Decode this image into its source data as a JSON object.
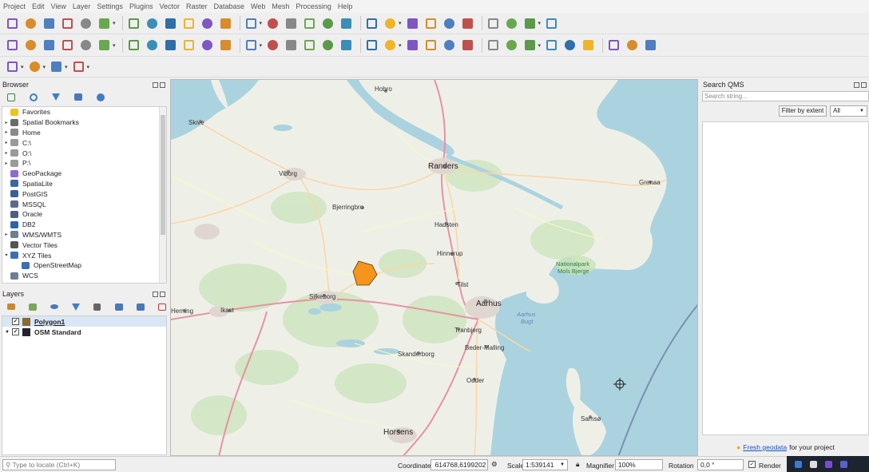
{
  "menubar": [
    "Project",
    "Edit",
    "View",
    "Layer",
    "Settings",
    "Plugins",
    "Vector",
    "Raster",
    "Database",
    "Web",
    "Mesh",
    "Processing",
    "Help"
  ],
  "toolbar_icons": {
    "row1": [
      "new-project-icon",
      "open-project-icon",
      "save-project-icon",
      "save-as-icon",
      "print-layout-icon",
      "style-manager-icon",
      "pan-icon",
      "pan-to-selection-icon",
      "zoom-in-icon",
      "zoom-out-icon",
      "zoom-full-icon",
      "zoom-selection-icon",
      "zoom-layer-icon",
      "zoom-native-icon",
      "zoom-last-icon",
      "zoom-next-icon",
      "new-bookmark-icon",
      "show-bookmarks-icon",
      "refresh-icon",
      "temporal-icon",
      "identify-icon",
      "attribute-table-icon",
      "processing-toolbox-icon",
      "statistics-icon",
      "measure-icon",
      "map-tips-icon",
      "select-icon",
      "text-annotation-icon"
    ],
    "row2": [
      "data-source-manager-icon",
      "new-geopackage-layer-icon",
      "new-shapefile-icon",
      "new-spatialite-icon",
      "new-temporary-layer-icon",
      "new-virtual-layer-icon",
      "current-edits-icon",
      "toggle-editing-icon",
      "save-edits-icon",
      "add-polygon-icon",
      "vertex-tool-icon",
      "modify-attributes-icon",
      "delete-selected-icon",
      "cut-features-icon",
      "copy-features-icon",
      "paste-features-icon",
      "undo-icon",
      "redo-icon",
      "label-icon",
      "label-pin-icon",
      "label-show-icon",
      "label-change-icon",
      "label-rotate-icon",
      "label-move-icon",
      "label-diagram-icon",
      "label-layer-icon",
      "label-hide-icon",
      "quickmapservices-icon",
      "quickmapservices-search-icon",
      "osm-icon",
      "python-console-icon",
      "plane-icon",
      "help-icon"
    ],
    "row3": [
      "select-features-icon",
      "deselect-icon",
      "select-by-expression-icon",
      "select-by-location-icon"
    ]
  },
  "browser": {
    "title": "Browser",
    "items": [
      {
        "label": "Favorites",
        "icon": "star-icon",
        "expander": "",
        "color": "#f2c21b"
      },
      {
        "label": "Spatial Bookmarks",
        "icon": "bookmark-icon",
        "expander": "▸",
        "color": "#6b6b6b"
      },
      {
        "label": "Home",
        "icon": "home-folder-icon",
        "expander": "▸",
        "color": "#8a8a8a"
      },
      {
        "label": "C:\\",
        "icon": "drive-icon",
        "expander": "▸",
        "color": "#9a9a9a"
      },
      {
        "label": "O:\\",
        "icon": "drive-icon",
        "expander": "▸",
        "color": "#9a9a9a"
      },
      {
        "label": "P:\\",
        "icon": "drive-icon",
        "expander": "▸",
        "color": "#9a9a9a"
      },
      {
        "label": "GeoPackage",
        "icon": "geopackage-icon",
        "expander": "",
        "color": "#8a6bd1"
      },
      {
        "label": "SpatiaLite",
        "icon": "spatialite-icon",
        "expander": "",
        "color": "#3a67a8"
      },
      {
        "label": "PostGIS",
        "icon": "postgis-icon",
        "expander": "",
        "color": "#3a5f93"
      },
      {
        "label": "MSSQL",
        "icon": "mssql-icon",
        "expander": "",
        "color": "#5a6a8a"
      },
      {
        "label": "Oracle",
        "icon": "oracle-icon",
        "expander": "",
        "color": "#4a5f88"
      },
      {
        "label": "DB2",
        "icon": "db2-icon",
        "expander": "",
        "color": "#2e63a7"
      },
      {
        "label": "WMS/WMTS",
        "icon": "wms-icon",
        "expander": "▸",
        "color": "#6b7f95"
      },
      {
        "label": "Vector Tiles",
        "icon": "vector-tiles-icon",
        "expander": "",
        "color": "#555"
      },
      {
        "label": "XYZ Tiles",
        "icon": "xyz-tiles-icon",
        "expander": "▾",
        "color": "#3d6eb4"
      },
      {
        "label": "OpenStreetMap",
        "icon": "tile-grid-icon",
        "expander": "",
        "color": "#3d6eb4",
        "indent": true
      },
      {
        "label": "WCS",
        "icon": "wcs-icon",
        "expander": "",
        "color": "#6b7f95"
      }
    ]
  },
  "layers": {
    "title": "Layers",
    "items": [
      {
        "label": "Polygon1",
        "checked": "✓",
        "icon_color": "#8a6a30",
        "selected": true,
        "underline": true
      },
      {
        "label": "OSM Standard",
        "checked": "✓",
        "icon_color": "#223",
        "selected": false,
        "underline": false
      }
    ]
  },
  "map": {
    "places": {
      "hobro": "Hobro",
      "skive": "Skive",
      "randers": "Randers",
      "viborg": "Viborg",
      "grenaa": "Grenaa",
      "bjerringbro": "Bjerringbro",
      "hadsten": "Hadsten",
      "hinnerup": "Hinnerup",
      "nationalpark": "Nationalpark",
      "mols": "Mols Bjerge",
      "tilst": "Tilst",
      "silkeborg": "Silkeborg",
      "aarhus": "Aarhus",
      "herning": "Herning",
      "ikast": "Ikast",
      "aarhus_bugt": "Aarhus",
      "bugt": "Bugt",
      "tranbjerg": "Tranbjerg",
      "beder": "Beder-Malling",
      "skanderborg": "Skanderborg",
      "odder": "Odder",
      "samso": "Samsø",
      "horsens": "Horsens"
    },
    "polygon_color": "#f7941d"
  },
  "qms": {
    "title": "Search QMS",
    "search_placeholder": "Search string...",
    "filter_label": "Filter by extent",
    "filter_value": "All",
    "footer_link": "Fresh geodata",
    "footer_text": "for your project"
  },
  "status": {
    "locator_placeholder": "Type to locate (Ctrl+K)",
    "coordinate_label": "Coordinate",
    "coordinate_value": "614768,6199202",
    "scale_label": "Scale",
    "scale_value": "1:539141",
    "magnifier_label": "Magnifier",
    "magnifier_value": "100%",
    "rotation_label": "Rotation",
    "rotation_value": "0,0 °",
    "render_label": "Render",
    "render_checked": "✓"
  }
}
